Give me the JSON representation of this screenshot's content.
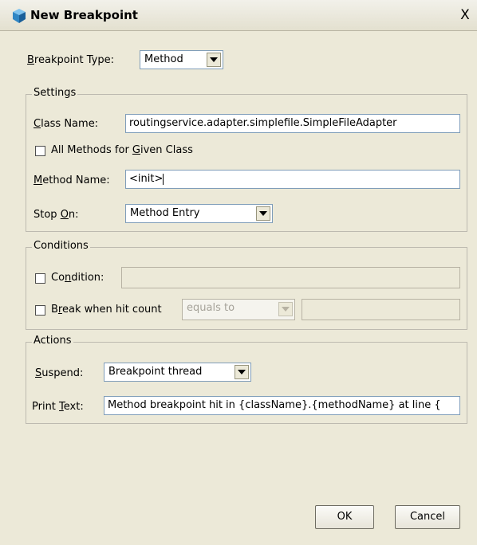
{
  "window": {
    "title": "New Breakpoint",
    "close_label": "X"
  },
  "breakpoint_type": {
    "label_mnemonic": "B",
    "label_rest": "reakpoint Type:",
    "value": "Method"
  },
  "settings": {
    "title": "Settings",
    "class_name_mnemonic": "C",
    "class_name_rest": "lass Name:",
    "class_name_value": "routingservice.adapter.simplefile.SimpleFileAdapter",
    "all_methods_prefix": "All Methods for ",
    "all_methods_mnemonic": "G",
    "all_methods_rest": "iven Class",
    "all_methods_checked": false,
    "method_name_mnemonic": "M",
    "method_name_rest": "ethod Name:",
    "method_name_value": "<init>",
    "stop_on_prefix": "Stop ",
    "stop_on_mnemonic": "O",
    "stop_on_rest": "n:",
    "stop_on_value": "Method Entry"
  },
  "conditions": {
    "title": "Conditions",
    "condition_prefix": "Co",
    "condition_mnemonic": "n",
    "condition_rest": "dition:",
    "condition_checked": false,
    "condition_value": "",
    "hit_count_prefix": "B",
    "hit_count_mnemonic": "r",
    "hit_count_rest": "eak when hit count",
    "hit_count_checked": false,
    "hit_count_operator": "equals to",
    "hit_count_value": ""
  },
  "actions": {
    "title": "Actions",
    "suspend_mnemonic": "S",
    "suspend_rest": "uspend:",
    "suspend_value": "Breakpoint thread",
    "print_text_prefix": "Print ",
    "print_text_mnemonic": "T",
    "print_text_rest": "ext:",
    "print_text_value": "Method breakpoint hit in {className}.{methodName} at line {"
  },
  "buttons": {
    "ok": "OK",
    "cancel": "Cancel"
  },
  "icons": {
    "title_icon": "breakpoint-cube-icon",
    "combo_arrow": "chevron-down-icon"
  }
}
